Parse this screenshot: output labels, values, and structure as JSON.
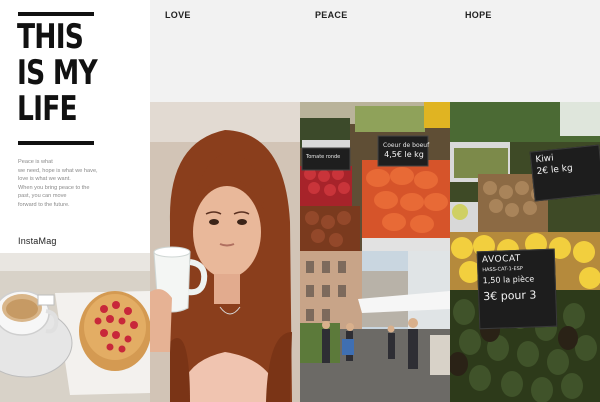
{
  "title_panel": {
    "title_lines": [
      "THIS",
      "IS MY",
      "LIFE"
    ],
    "quote_lines": [
      "Peace is what",
      "we need, hope is what we have,",
      "love is what we want.",
      "When you bring peace to the",
      "past, you can move",
      "forward to the future."
    ],
    "brand": "InstaMag"
  },
  "headers": {
    "love": "LOVE",
    "peace": "PEACE",
    "hope": "HOPE"
  },
  "chalkboards": {
    "market_price": "4,5€ le kg",
    "avocat_line1": "AVOCAT",
    "avocat_line2": "HASS-CAT-1-ESP",
    "avocat_line3": "1,50 la pièce",
    "avocat_line4": "3€ pour 3",
    "kiwi_line1": "Kiwi",
    "kiwi_line2": "2€ le kg"
  },
  "colors": {
    "title_text": "#111111",
    "header_background": "#f2f2f2",
    "quote_text": "#8a8a8a"
  }
}
